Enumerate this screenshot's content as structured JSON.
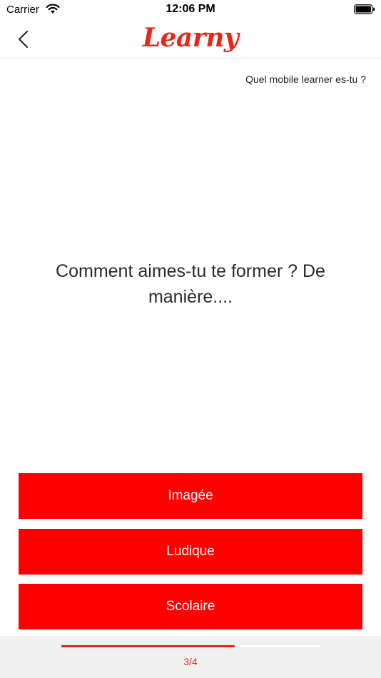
{
  "status_bar": {
    "carrier": "Carrier",
    "time": "12:06 PM",
    "icons": [
      "wifi-icon",
      "battery-icon"
    ]
  },
  "nav": {
    "back_icon": "chevron-left-icon",
    "brand": "Learny"
  },
  "quiz": {
    "name": "Quel mobile learner es-tu ?",
    "question": "Comment aimes-tu te former ? De manière....",
    "answers": [
      {
        "label": "Imagée"
      },
      {
        "label": "Ludique"
      },
      {
        "label": "Scolaire"
      }
    ]
  },
  "progress": {
    "counter": "3/4",
    "fraction": 0.67
  },
  "colors": {
    "accent": "#e8271b",
    "button": "#ff0000",
    "footer_bg": "#f0f0f0"
  }
}
